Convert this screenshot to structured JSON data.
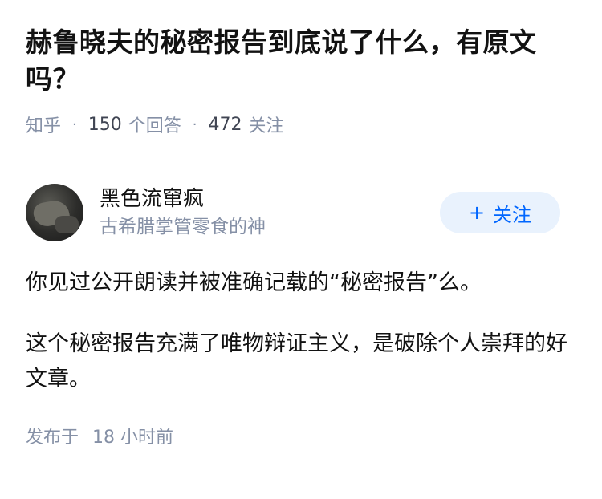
{
  "question": {
    "title": "赫鲁晓夫的秘密报告到底说了什么，有原文吗？",
    "source": "知乎",
    "answer_count": "150",
    "answer_label": "个回答",
    "follower_count": "472",
    "follower_label": "关注"
  },
  "answer": {
    "author": {
      "name": "黑色流窜疯",
      "bio": "古希腊掌管零食的神",
      "avatar_icon": "avatar-photo"
    },
    "follow_button": {
      "icon": "plus-icon",
      "plus": "+",
      "label": "关注"
    },
    "paragraphs": [
      "你见过公开朗读并被准确记载的“秘密报告”么。",
      "这个秘密报告充满了唯物辩证主义，是破除个人崇拜的好文章。"
    ],
    "time_prefix": "发布于",
    "time_value": "18 小时前"
  },
  "colors": {
    "accent": "#0066ff",
    "follow_bg": "#e9f2fd",
    "meta": "#8590a6"
  }
}
